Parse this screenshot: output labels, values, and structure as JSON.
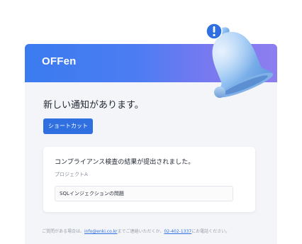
{
  "header": {
    "logo_text": "OFFen"
  },
  "main": {
    "title": "新しい通知があります。",
    "shortcut_label": "ショートカット"
  },
  "card": {
    "title": "コンプライアンス検査の結果が提出されました。",
    "project": "プロジェクトA",
    "issue": "SQLインジェクションの問題"
  },
  "footer": {
    "prefix": "ご質問がある場合は、",
    "email": "info@enki.co.kr",
    "middle": "までご連絡いただくか、",
    "phone": "02-402-1337",
    "suffix": "にお電話ください。"
  },
  "icons": {
    "bell": "bell-icon",
    "alert": "exclamation-icon"
  },
  "colors": {
    "header_start": "#3b7bf0",
    "header_end": "#8d7ef0",
    "accent": "#2f6fe0",
    "bell": "#8fc0f2"
  }
}
